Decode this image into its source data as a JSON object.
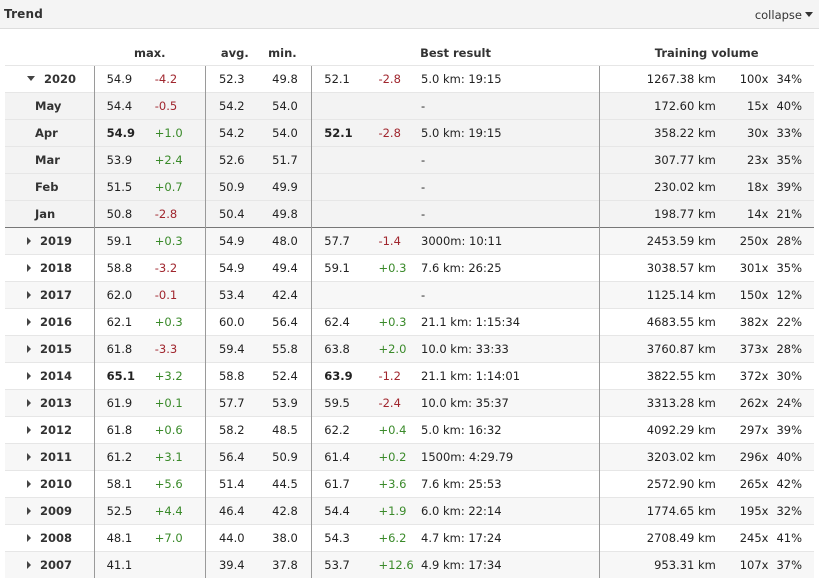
{
  "header": {
    "title": "Trend",
    "collapse_label": "collapse"
  },
  "columns": {
    "max": "max.",
    "avg": "avg.",
    "min": "min.",
    "best": "Best result",
    "volume": "Training volume"
  },
  "rows": [
    {
      "label": "2020",
      "type": "year",
      "expanded": true,
      "max": "54.9",
      "max_d": "-4.2",
      "avg": "52.3",
      "min": "49.8",
      "best": "52.1",
      "best_d": "-2.8",
      "result": "5.0 km: 19:15",
      "km": "1267.38 km",
      "count": "100x",
      "pct": "34%"
    },
    {
      "label": "May",
      "type": "month",
      "max": "54.4",
      "max_d": "-0.5",
      "avg": "54.2",
      "min": "54.0",
      "best": "",
      "best_d": "",
      "result": "-",
      "km": "172.60 km",
      "count": "15x",
      "pct": "40%"
    },
    {
      "label": "Apr",
      "type": "month",
      "max": "54.9",
      "max_bold": true,
      "max_d": "+1.0",
      "avg": "54.2",
      "min": "54.0",
      "best": "52.1",
      "best_bold": true,
      "best_d": "-2.8",
      "result": "5.0 km: 19:15",
      "km": "358.22 km",
      "count": "30x",
      "pct": "33%"
    },
    {
      "label": "Mar",
      "type": "month",
      "max": "53.9",
      "max_d": "+2.4",
      "avg": "52.6",
      "min": "51.7",
      "best": "",
      "best_d": "",
      "result": "-",
      "km": "307.77 km",
      "count": "23x",
      "pct": "35%"
    },
    {
      "label": "Feb",
      "type": "month",
      "max": "51.5",
      "max_d": "+0.7",
      "avg": "50.9",
      "min": "49.9",
      "best": "",
      "best_d": "",
      "result": "-",
      "km": "230.02 km",
      "count": "18x",
      "pct": "39%"
    },
    {
      "label": "Jan",
      "type": "month",
      "max": "50.8",
      "max_d": "-2.8",
      "avg": "50.4",
      "min": "49.8",
      "best": "",
      "best_d": "",
      "result": "-",
      "km": "198.77 km",
      "count": "14x",
      "pct": "21%"
    },
    {
      "label": "2019",
      "type": "year",
      "max": "59.1",
      "max_d": "+0.3",
      "avg": "54.9",
      "min": "48.0",
      "best": "57.7",
      "best_d": "-1.4",
      "result": "3000m: 10:11",
      "km": "2453.59 km",
      "count": "250x",
      "pct": "28%"
    },
    {
      "label": "2018",
      "type": "year",
      "max": "58.8",
      "max_d": "-3.2",
      "avg": "54.9",
      "min": "49.4",
      "best": "59.1",
      "best_d": "+0.3",
      "result": "7.6 km: 26:25",
      "km": "3038.57 km",
      "count": "301x",
      "pct": "35%"
    },
    {
      "label": "2017",
      "type": "year",
      "max": "62.0",
      "max_d": "-0.1",
      "avg": "53.4",
      "min": "42.4",
      "best": "",
      "best_d": "",
      "result": "-",
      "km": "1125.14 km",
      "count": "150x",
      "pct": "12%"
    },
    {
      "label": "2016",
      "type": "year",
      "max": "62.1",
      "max_d": "+0.3",
      "avg": "60.0",
      "min": "56.4",
      "best": "62.4",
      "best_d": "+0.3",
      "result": "21.1 km: 1:15:34",
      "km": "4683.55 km",
      "count": "382x",
      "pct": "22%"
    },
    {
      "label": "2015",
      "type": "year",
      "max": "61.8",
      "max_d": "-3.3",
      "avg": "59.4",
      "min": "55.8",
      "best": "63.8",
      "best_d": "+2.0",
      "result": "10.0 km: 33:33",
      "km": "3760.87 km",
      "count": "373x",
      "pct": "28%"
    },
    {
      "label": "2014",
      "type": "year",
      "max": "65.1",
      "max_bold": true,
      "max_d": "+3.2",
      "avg": "58.8",
      "min": "52.4",
      "best": "63.9",
      "best_bold": true,
      "best_d": "-1.2",
      "result": "21.1 km: 1:14:01",
      "km": "3822.55 km",
      "count": "372x",
      "pct": "30%"
    },
    {
      "label": "2013",
      "type": "year",
      "max": "61.9",
      "max_d": "+0.1",
      "avg": "57.7",
      "min": "53.9",
      "best": "59.5",
      "best_d": "-2.4",
      "result": "10.0 km: 35:37",
      "km": "3313.28 km",
      "count": "262x",
      "pct": "24%"
    },
    {
      "label": "2012",
      "type": "year",
      "max": "61.8",
      "max_d": "+0.6",
      "avg": "58.2",
      "min": "48.5",
      "best": "62.2",
      "best_d": "+0.4",
      "result": "5.0 km: 16:32",
      "km": "4092.29 km",
      "count": "297x",
      "pct": "39%"
    },
    {
      "label": "2011",
      "type": "year",
      "max": "61.2",
      "max_d": "+3.1",
      "avg": "56.4",
      "min": "50.9",
      "best": "61.4",
      "best_d": "+0.2",
      "result": "1500m: 4:29.79",
      "km": "3203.02 km",
      "count": "296x",
      "pct": "40%"
    },
    {
      "label": "2010",
      "type": "year",
      "max": "58.1",
      "max_d": "+5.6",
      "avg": "51.4",
      "min": "44.5",
      "best": "61.7",
      "best_d": "+3.6",
      "result": "7.6 km: 25:53",
      "km": "2572.90 km",
      "count": "265x",
      "pct": "42%"
    },
    {
      "label": "2009",
      "type": "year",
      "max": "52.5",
      "max_d": "+4.4",
      "avg": "46.4",
      "min": "42.8",
      "best": "54.4",
      "best_d": "+1.9",
      "result": "6.0 km: 22:14",
      "km": "1774.65 km",
      "count": "195x",
      "pct": "32%"
    },
    {
      "label": "2008",
      "type": "year",
      "max": "48.1",
      "max_d": "+7.0",
      "avg": "44.0",
      "min": "38.0",
      "best": "54.3",
      "best_d": "+6.2",
      "result": "4.7 km: 17:24",
      "km": "2708.49 km",
      "count": "245x",
      "pct": "41%"
    },
    {
      "label": "2007",
      "type": "year",
      "max": "41.1",
      "max_d": "",
      "avg": "39.4",
      "min": "37.8",
      "best": "53.7",
      "best_d": "+12.6",
      "result": "4.9 km: 17:34",
      "km": "953.31 km",
      "count": "107x",
      "pct": "37%"
    }
  ]
}
